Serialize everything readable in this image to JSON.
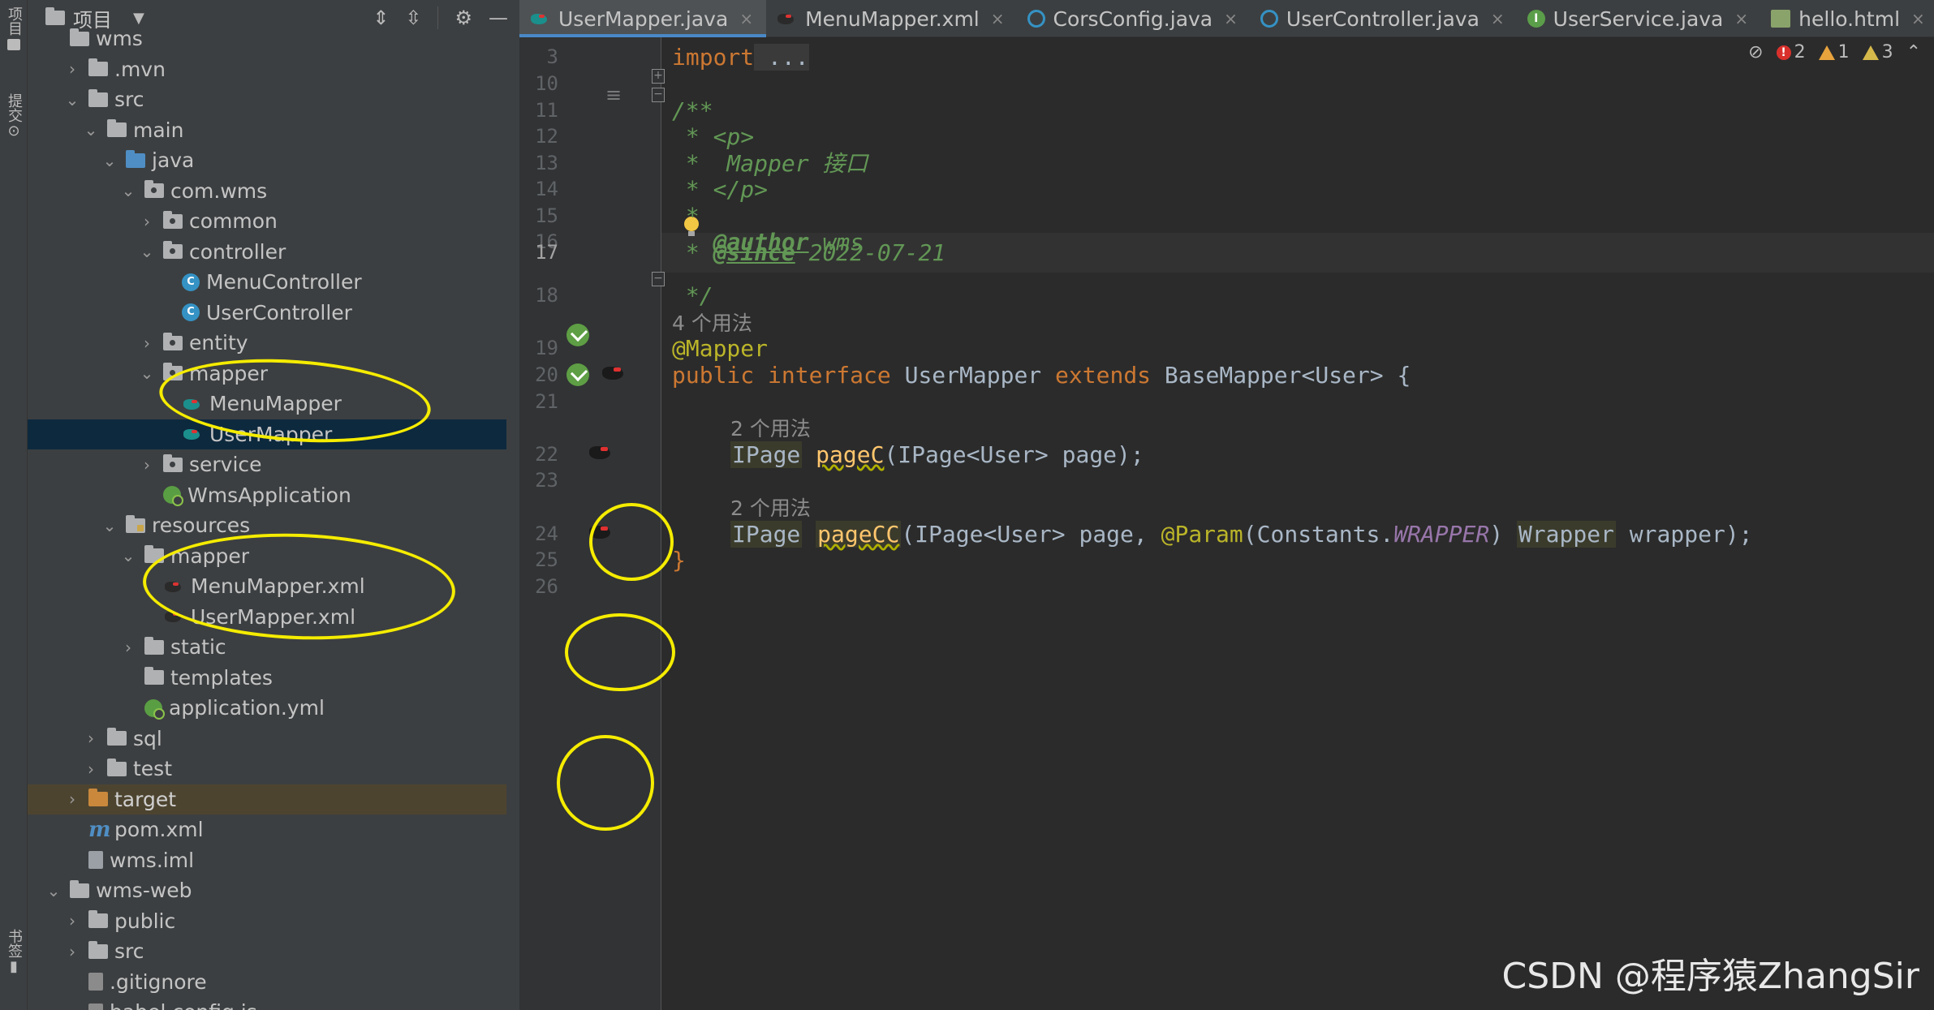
{
  "left_strip": {
    "project_label": "项目",
    "commit_label": "提交",
    "bookmarks_label": "书签"
  },
  "project_panel": {
    "title": "项目",
    "tree": [
      {
        "label": "wms",
        "depth": 1,
        "arrow": "",
        "icon": "folder"
      },
      {
        "label": ".mvn",
        "depth": 2,
        "arrow": ">",
        "icon": "folder"
      },
      {
        "label": "src",
        "depth": 2,
        "arrow": "v",
        "icon": "folder"
      },
      {
        "label": "main",
        "depth": 3,
        "arrow": "v",
        "icon": "folder"
      },
      {
        "label": "java",
        "depth": 4,
        "arrow": "v",
        "icon": "folder-blue"
      },
      {
        "label": "com.wms",
        "depth": 5,
        "arrow": "v",
        "icon": "package"
      },
      {
        "label": "common",
        "depth": 6,
        "arrow": ">",
        "icon": "package"
      },
      {
        "label": "controller",
        "depth": 6,
        "arrow": "v",
        "icon": "package"
      },
      {
        "label": "MenuController",
        "depth": 7,
        "arrow": "",
        "icon": "class"
      },
      {
        "label": "UserController",
        "depth": 7,
        "arrow": "",
        "icon": "class"
      },
      {
        "label": "entity",
        "depth": 6,
        "arrow": ">",
        "icon": "package"
      },
      {
        "label": "mapper",
        "depth": 6,
        "arrow": "v",
        "icon": "package"
      },
      {
        "label": "MenuMapper",
        "depth": 7,
        "arrow": "",
        "icon": "mapper-teal"
      },
      {
        "label": "UserMapper",
        "depth": 7,
        "arrow": "",
        "icon": "mapper-teal",
        "selected": true
      },
      {
        "label": "service",
        "depth": 6,
        "arrow": ">",
        "icon": "package"
      },
      {
        "label": "WmsApplication",
        "depth": 6,
        "arrow": "",
        "icon": "spring"
      },
      {
        "label": "resources",
        "depth": 4,
        "arrow": "v",
        "icon": "folder-res"
      },
      {
        "label": "mapper",
        "depth": 5,
        "arrow": "v",
        "icon": "folder"
      },
      {
        "label": "MenuMapper.xml",
        "depth": 6,
        "arrow": "",
        "icon": "mapper"
      },
      {
        "label": "UserMapper.xml",
        "depth": 6,
        "arrow": "",
        "icon": "mapper"
      },
      {
        "label": "static",
        "depth": 5,
        "arrow": ">",
        "icon": "folder"
      },
      {
        "label": "templates",
        "depth": 5,
        "arrow": "",
        "icon": "folder"
      },
      {
        "label": "application.yml",
        "depth": 5,
        "arrow": "",
        "icon": "spring"
      },
      {
        "label": "sql",
        "depth": 3,
        "arrow": ">",
        "icon": "folder"
      },
      {
        "label": "test",
        "depth": 3,
        "arrow": ">",
        "icon": "folder"
      },
      {
        "label": "target",
        "depth": 2,
        "arrow": ">",
        "icon": "folder-orange",
        "target": true
      },
      {
        "label": "pom.xml",
        "depth": 2,
        "arrow": "",
        "icon": "maven"
      },
      {
        "label": "wms.iml",
        "depth": 2,
        "arrow": "",
        "icon": "iml"
      },
      {
        "label": "wms-web",
        "depth": 1,
        "arrow": "v",
        "icon": "folder"
      },
      {
        "label": "public",
        "depth": 2,
        "arrow": ">",
        "icon": "folder"
      },
      {
        "label": "src",
        "depth": 2,
        "arrow": ">",
        "icon": "folder"
      },
      {
        "label": ".gitignore",
        "depth": 2,
        "arrow": "",
        "icon": "git"
      },
      {
        "label": "babel.config.js",
        "depth": 2,
        "arrow": "",
        "icon": "js"
      }
    ]
  },
  "tabs": [
    {
      "label": "UserMapper.java",
      "icon": "mapper-teal",
      "active": true
    },
    {
      "label": "MenuMapper.xml",
      "icon": "mapper",
      "active": false
    },
    {
      "label": "CorsConfig.java",
      "icon": "c",
      "active": false
    },
    {
      "label": "UserController.java",
      "icon": "c",
      "active": false
    },
    {
      "label": "UserService.java",
      "icon": "i",
      "active": false
    },
    {
      "label": "hello.html",
      "icon": "h",
      "active": false
    }
  ],
  "inspections": {
    "errors": "2",
    "warnings": "1",
    "weak_warnings": "3"
  },
  "editor": {
    "current_line": "17",
    "line_numbers": [
      "3",
      "10",
      "11",
      "12",
      "13",
      "14",
      "15",
      "16",
      "17",
      "18",
      "19",
      "20",
      "21",
      "22",
      "23",
      "24",
      "25",
      "26"
    ],
    "code": {
      "l3_kw": "import",
      "l3_fold": " ...",
      "l11": "/**",
      "l12": " * <p>",
      "l13": " *  Mapper 接口",
      "l14": " * </p>",
      "l15": " *",
      "l16_tag": "@author",
      "l16_val": " wms",
      "l17_pre": " * ",
      "l17_tag": "@since",
      "l17_val": " 2022-07-21",
      "l18": " */",
      "usages_4": "4 个用法",
      "l19": "@Mapper",
      "l20_public": "public",
      "l20_interface": "interface",
      "l20_name": "UserMapper",
      "l20_extends": "extends",
      "l20_base": "BaseMapper<User> {",
      "usages_2a": "2 个用法",
      "l22_type": "IPage",
      "l22_fn": "pageC",
      "l22_rest": "(IPage<User> page);",
      "usages_2b": "2 个用法",
      "l24_type": "IPage",
      "l24_fn": "pageCC",
      "l24_a": "(IPage<User> page, ",
      "l24_ann": "@Param",
      "l24_b": "(Constants.",
      "l24_const": "WRAPPER",
      "l24_c": ") ",
      "l24_wrap": "Wrapper",
      "l24_d": " wrapper);",
      "l25": "}"
    }
  },
  "watermark": "CSDN @程序猿ZhangSir"
}
